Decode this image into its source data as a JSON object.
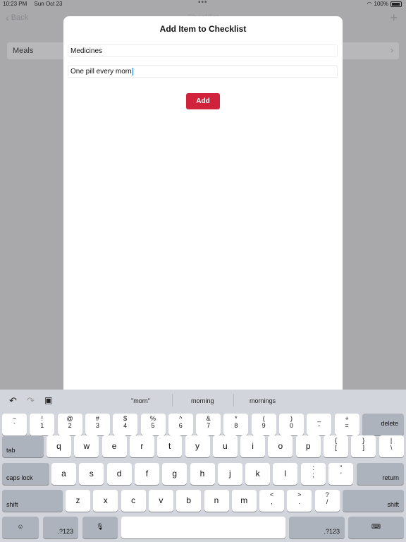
{
  "status": {
    "time": "10:23 PM",
    "date": "Sun Oct 23",
    "battery": "100%"
  },
  "nav": {
    "back": "Back",
    "title": "Checklist"
  },
  "list": {
    "meals": "Meals"
  },
  "modal": {
    "title": "Add Item to Checklist",
    "field1_value": "Medicines",
    "field2_value": "One pill every morn",
    "add_label": "Add"
  },
  "keyboard": {
    "suggestions": [
      "\"morn\"",
      "morning",
      "mornings"
    ],
    "icons": {
      "undo": "undo-icon",
      "redo": "redo-icon",
      "paste": "paste-icon",
      "emoji": "emoji-icon",
      "mic": "microphone-icon",
      "hide": "keyboard-dismiss-icon"
    },
    "num_row": [
      [
        "~",
        "`"
      ],
      [
        "!",
        "1"
      ],
      [
        "@",
        "2"
      ],
      [
        "#",
        "3"
      ],
      [
        "$",
        "4"
      ],
      [
        "%",
        "5"
      ],
      [
        "^",
        "6"
      ],
      [
        "&",
        "7"
      ],
      [
        "*",
        "8"
      ],
      [
        "(",
        "9"
      ],
      [
        ")",
        "0"
      ],
      [
        "_",
        "-"
      ],
      [
        "+",
        "="
      ]
    ],
    "delete": "delete",
    "tab": "tab",
    "row1": [
      "q",
      "w",
      "e",
      "r",
      "t",
      "y",
      "u",
      "i",
      "o",
      "p"
    ],
    "row1_sym": [
      [
        "{",
        "["
      ],
      [
        "}",
        "]"
      ],
      [
        "|",
        "\\"
      ]
    ],
    "caps": "caps lock",
    "row2": [
      "a",
      "s",
      "d",
      "f",
      "g",
      "h",
      "j",
      "k",
      "l"
    ],
    "row2_sym": [
      [
        ":",
        ";"
      ],
      [
        "\"",
        "'"
      ]
    ],
    "return": "return",
    "shift": "shift",
    "row3": [
      "z",
      "x",
      "c",
      "v",
      "b",
      "n",
      "m"
    ],
    "row3_sym": [
      [
        "<",
        ","
      ],
      [
        ">",
        "."
      ],
      [
        "?",
        "/"
      ]
    ],
    "num_toggle": ".?123"
  },
  "colors": {
    "accent": "#d0223a",
    "cursor": "#1a73e8"
  }
}
